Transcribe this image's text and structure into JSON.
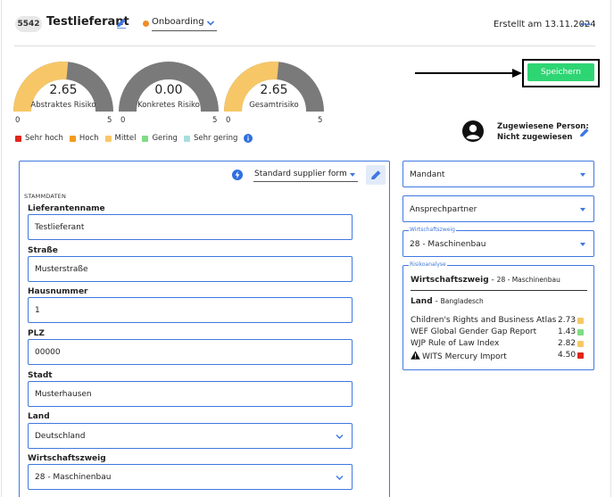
{
  "header": {
    "id": "5542",
    "title": "Testlieferant",
    "status": "Onboarding",
    "status_color": "#f28c28",
    "created": "Erstellt am 13.11.2024"
  },
  "gauges": [
    {
      "value": "2.65",
      "fraction": 0.53,
      "label": "Abstraktes Risiko",
      "min": "0",
      "max": "5"
    },
    {
      "value": "0.00",
      "fraction": 0.0,
      "label": "Konkretes Risiko",
      "min": "0",
      "max": "5"
    },
    {
      "value": "2.65",
      "fraction": 0.53,
      "label": "Gesamtrisiko",
      "min": "0",
      "max": "5"
    }
  ],
  "legend": [
    {
      "label": "Sehr hoch",
      "color": "#e0261c"
    },
    {
      "label": "Hoch",
      "color": "#f29b1d"
    },
    {
      "label": "Mittel",
      "color": "#f7c767"
    },
    {
      "label": "Gering",
      "color": "#7fdc84"
    },
    {
      "label": "Sehr gering",
      "color": "#a9dede"
    }
  ],
  "colors": {
    "accent": "#3f78e0",
    "save": "#2ed573",
    "gauge_fill": "#f7c767",
    "gauge_track": "#7a7a7a"
  },
  "save_label": "Speichern",
  "assigned": {
    "title": "Zugewiesene Person:",
    "value": "Nicht zugewiesen"
  },
  "form": {
    "template": "Standard supplier form",
    "section": "STAMMDATEN",
    "fields": [
      {
        "label": "Lieferantenname",
        "value": "Testlieferant"
      },
      {
        "label": "Straße",
        "value": "Musterstraße"
      },
      {
        "label": "Hausnummer",
        "value": "1"
      },
      {
        "label": "PLZ",
        "value": "00000"
      },
      {
        "label": "Stadt",
        "value": "Musterhausen"
      },
      {
        "label": "Land",
        "value": "Deutschland"
      },
      {
        "label": "Wirtschaftszweig",
        "value": "28 - Maschinenbau"
      }
    ]
  },
  "right": {
    "mandant": "Mandant",
    "ansprechpartner": "Ansprechpartner",
    "wz_label": "Wirtschaftszweig",
    "wz_value": "28 - Maschinenbau",
    "risk": {
      "label": "Risikoanalyse",
      "wz_title": "Wirtschaftszweig",
      "wz_detail": "28 - Maschinenbau",
      "land_title": "Land",
      "land_detail": "Bangladesch",
      "indices": [
        {
          "name": "Children's Rights and Business Atlas",
          "value": "2.73",
          "color": "#f7c767"
        },
        {
          "name": "WEF Global Gender Gap Report",
          "value": "1.43",
          "color": "#7fdc84"
        },
        {
          "name": "WJP Rule of Law Index",
          "value": "2.82",
          "color": "#f7c767"
        },
        {
          "name": "WITS Mercury Import",
          "value": "4.50",
          "color": "#e0261c",
          "warning_icon": "warning-triangle-icon"
        }
      ]
    }
  }
}
